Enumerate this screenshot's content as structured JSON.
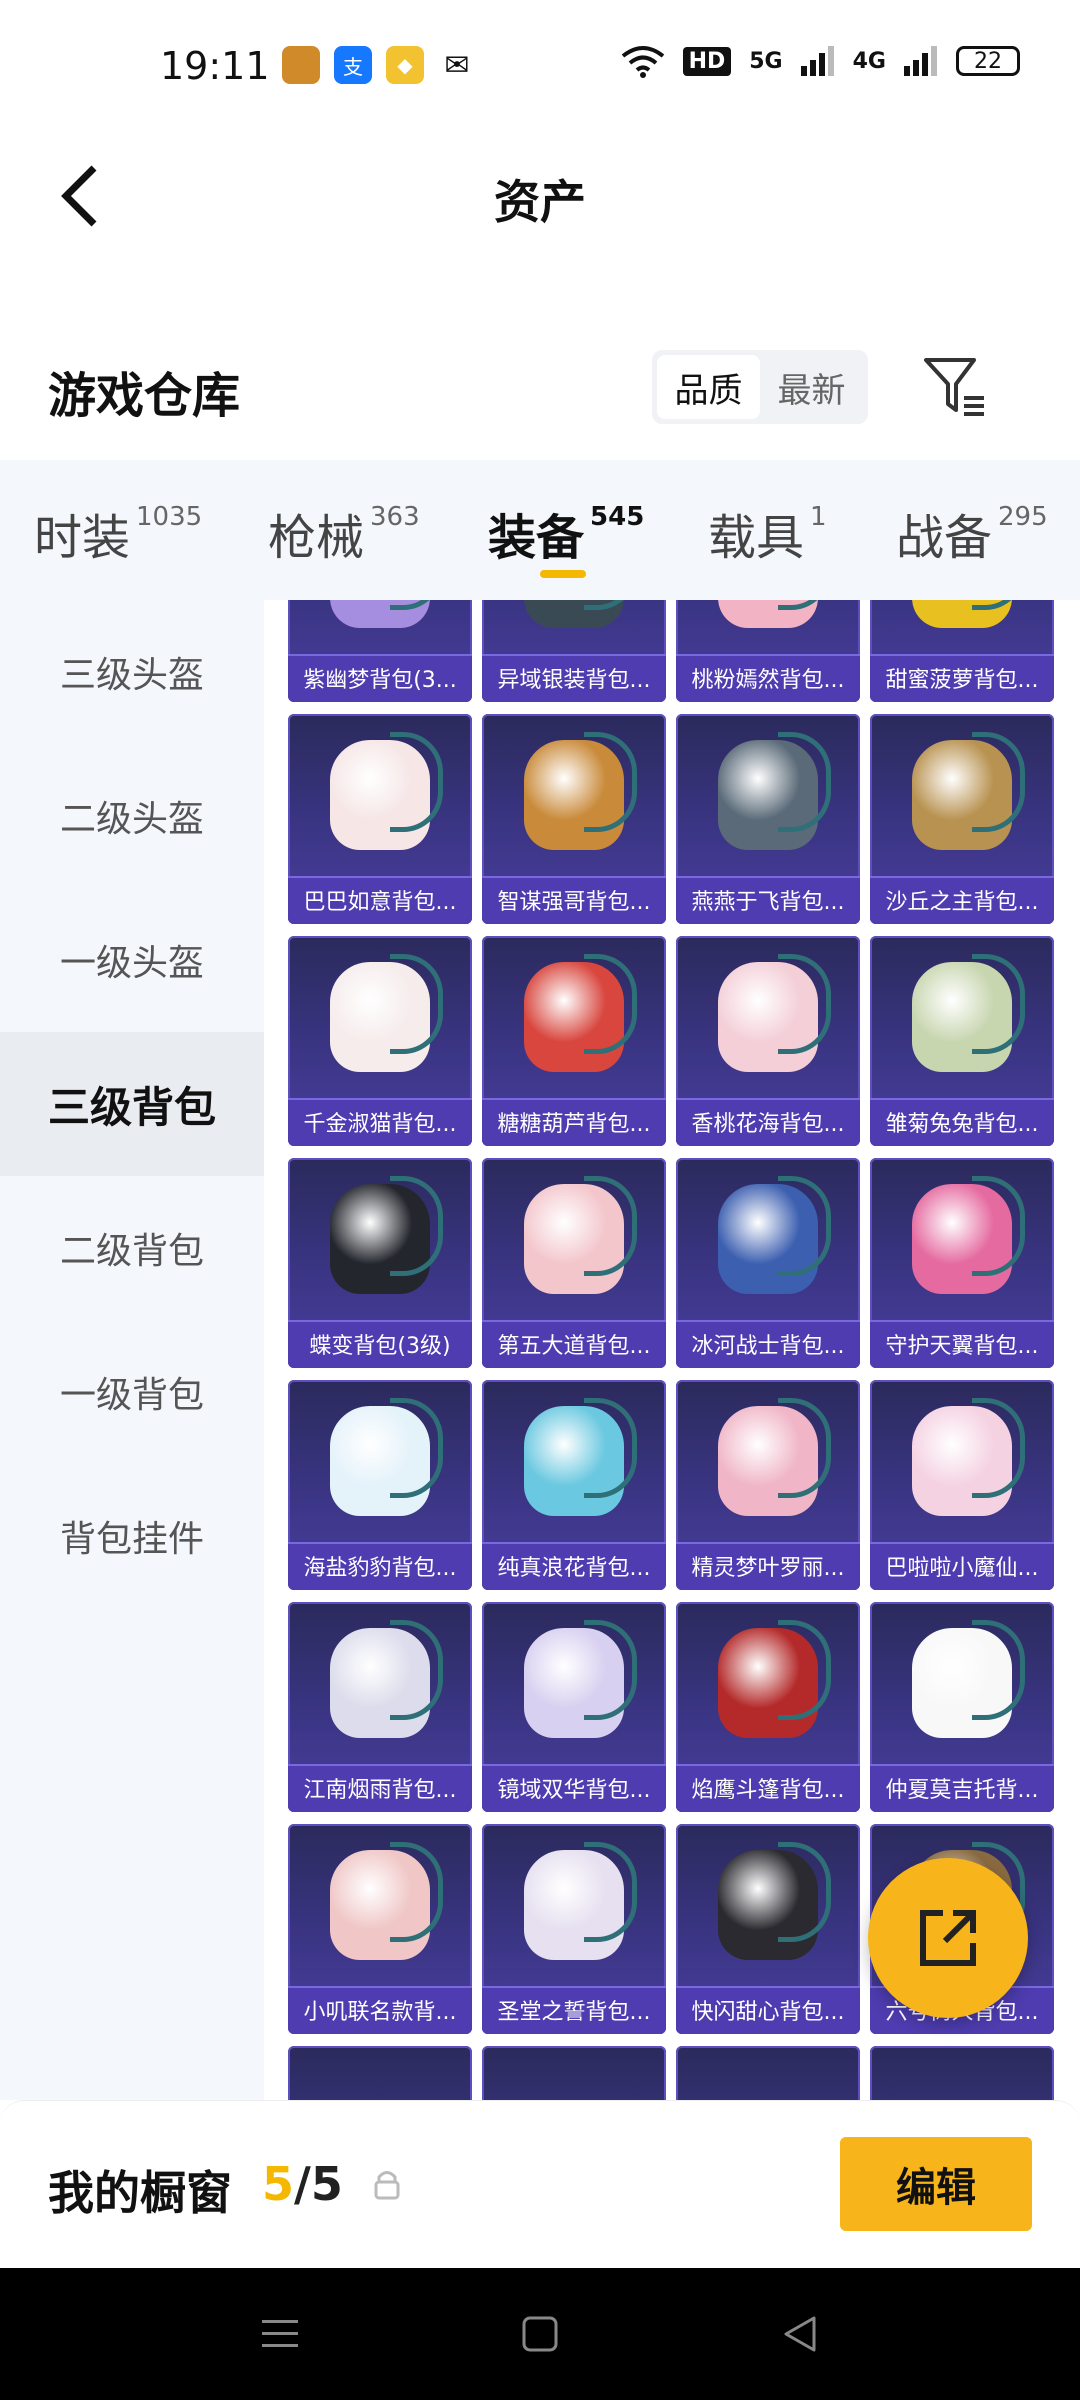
{
  "status_bar": {
    "time": "19:11",
    "net_label": "5G",
    "net_label2": "4G",
    "hd_label": "HD",
    "battery": "22"
  },
  "header": {
    "title": "资产",
    "back_icon": "chevron-left-icon"
  },
  "section": {
    "title": "游戏仓库",
    "sort_options": [
      "品质",
      "最新"
    ],
    "sort_active": "品质"
  },
  "tabs": [
    {
      "label": "时装",
      "count": "1035"
    },
    {
      "label": "枪械",
      "count": "363"
    },
    {
      "label": "装备",
      "count": "545"
    },
    {
      "label": "载具",
      "count": "1"
    },
    {
      "label": "战备",
      "count": "295"
    }
  ],
  "active_tab": "装备",
  "sidebar": {
    "items": [
      "三级头盔",
      "二级头盔",
      "一级头盔",
      "三级背包",
      "二级背包",
      "一级背包",
      "背包挂件"
    ],
    "active": "三级背包"
  },
  "items": [
    {
      "name": "紫幽梦背包(3...",
      "color": "#a58de0"
    },
    {
      "name": "异域银装背包...",
      "color": "#3a4a55"
    },
    {
      "name": "桃粉嫣然背包...",
      "color": "#f2b4c4"
    },
    {
      "name": "甜蜜菠萝背包...",
      "color": "#e8c020"
    },
    {
      "name": "巴巴如意背包...",
      "color": "#f6e6e6"
    },
    {
      "name": "智谋强哥背包...",
      "color": "#c98a3a"
    },
    {
      "name": "燕燕于飞背包...",
      "color": "#5a6a78"
    },
    {
      "name": "沙丘之主背包...",
      "color": "#b89250"
    },
    {
      "name": "千金淑猫背包...",
      "color": "#f6ecec"
    },
    {
      "name": "糖糖葫芦背包...",
      "color": "#d8463e"
    },
    {
      "name": "香桃花海背包...",
      "color": "#f4cfd8"
    },
    {
      "name": "雏菊兔兔背包...",
      "color": "#c8d6b0"
    },
    {
      "name": "蝶变背包(3级)",
      "color": "#23262d"
    },
    {
      "name": "第五大道背包...",
      "color": "#f3c6cc"
    },
    {
      "name": "冰河战士背包...",
      "color": "#3c5fb0"
    },
    {
      "name": "守护天翼背包...",
      "color": "#e56aa0"
    },
    {
      "name": "海盐豹豹背包...",
      "color": "#e4f2fa"
    },
    {
      "name": "纯真浪花背包...",
      "color": "#6ac8e0"
    },
    {
      "name": "精灵梦叶罗丽...",
      "color": "#f0b6c8"
    },
    {
      "name": "巴啦啦小魔仙...",
      "color": "#f5d2e2"
    },
    {
      "name": "江南烟雨背包...",
      "color": "#dcdcec"
    },
    {
      "name": "镜域双华背包...",
      "color": "#d8d0f0"
    },
    {
      "name": "焰鹰斗篷背包...",
      "color": "#b42a2a"
    },
    {
      "name": "仲夏莫吉托背...",
      "color": "#f8f8f8"
    },
    {
      "name": "小叽联名款背...",
      "color": "#f0c6c6"
    },
    {
      "name": "圣堂之誓背包...",
      "color": "#e6e0f0"
    },
    {
      "name": "快闪甜心背包...",
      "color": "#2a2a30"
    },
    {
      "name": "六号树人背包...",
      "color": "#8a6a40"
    }
  ],
  "showcase": {
    "label": "我的橱窗",
    "current": "5",
    "sep_total": "/5"
  },
  "edit_label": "编辑",
  "fab_icon": "share-external-icon"
}
